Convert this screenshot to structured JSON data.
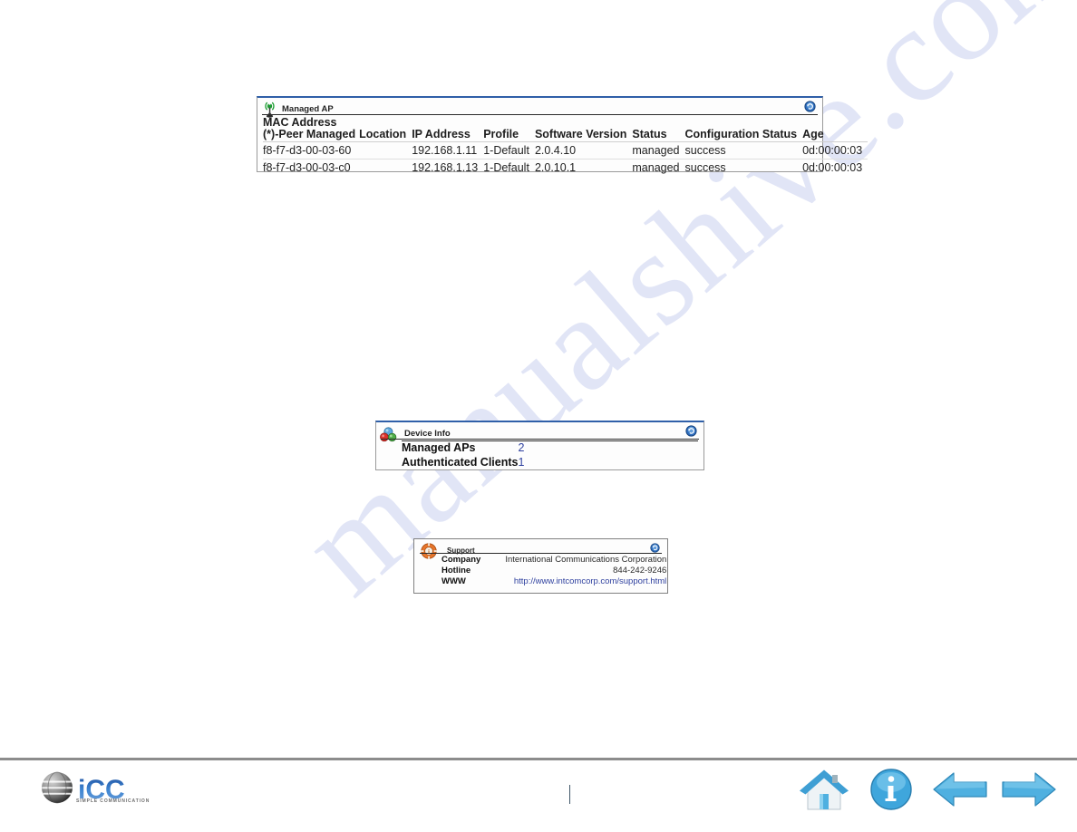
{
  "watermark": {
    "text": "manualshive.com"
  },
  "managed_ap": {
    "title": "Managed AP",
    "icon": "wireless-ap-icon",
    "refresh_icon": "refresh-icon",
    "columns": {
      "mac_line1": "MAC Address",
      "mac_line2": "(*)-Peer Managed",
      "location": "Location",
      "ip_address": "IP Address",
      "profile": "Profile",
      "software_version": "Software Version",
      "status": "Status",
      "configuration_status": "Configuration Status",
      "age": "Age"
    },
    "rows": [
      {
        "mac": "f8-f7-d3-00-03-60",
        "location": "",
        "ip_address": "192.168.1.11",
        "profile": "1-Default",
        "software_version": "2.0.4.10",
        "status": "managed",
        "configuration_status": "success",
        "age": "0d:00:00:03"
      },
      {
        "mac": "f8-f7-d3-00-03-c0",
        "location": "",
        "ip_address": "192.168.1.13",
        "profile": "1-Default",
        "software_version": "2.0.10.1",
        "status": "managed",
        "configuration_status": "success",
        "age": "0d:00:00:03"
      }
    ]
  },
  "device_info": {
    "title": "Device Info",
    "icon": "spheres-cluster-icon",
    "refresh_icon": "refresh-icon",
    "rows": [
      {
        "label": "Managed APs",
        "value": "2"
      },
      {
        "label": "Authenticated Clients",
        "value": "1"
      }
    ]
  },
  "support": {
    "title": "Support",
    "icon": "lifebuoy-icon",
    "refresh_icon": "refresh-icon",
    "rows": [
      {
        "label": "Company",
        "value": "International Communications Corporation",
        "is_link": false
      },
      {
        "label": "Hotline",
        "value": "844-242-9246",
        "is_link": false
      },
      {
        "label": "WWW",
        "value": "http://www.intcomcorp.com/support.html",
        "is_link": true
      }
    ]
  },
  "footer": {
    "logo_text": "iCC",
    "logo_tagline": "SIMPLE COMMUNICATION",
    "nav": [
      {
        "name": "home-icon",
        "label": "Home"
      },
      {
        "name": "info-icon",
        "label": "Info"
      },
      {
        "name": "back-arrow-icon",
        "label": "Back"
      },
      {
        "name": "forward-arrow-icon",
        "label": "Next"
      }
    ]
  },
  "colors": {
    "link": "#2d3f9e",
    "panel_border_top": "#2f5fa8",
    "nav_blue": "#45a8dd",
    "logo_blue": "#2f6fc0",
    "rule_grey": "#8c8c8c"
  }
}
